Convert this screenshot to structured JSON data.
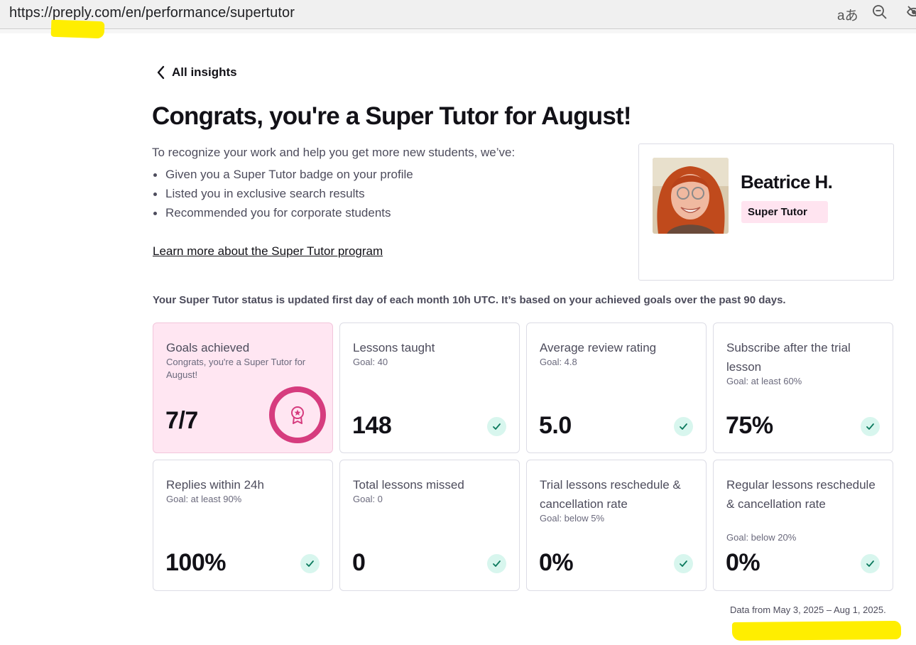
{
  "browser": {
    "url": "https://preply.com/en/performance/supertutor",
    "translate_icon": "aあ"
  },
  "header": {
    "back_label": "All insights",
    "title": "Congrats, you're a Super Tutor for August!"
  },
  "intro": {
    "lead": "To recognize your work and help you get more new students, we’ve:",
    "bullets": [
      "Given you a Super Tutor badge on your profile",
      "Listed you in exclusive search results",
      "Recommended you for corporate students"
    ],
    "learn_more": "Learn more about the Super Tutor program"
  },
  "profile": {
    "name": "Beatrice H.",
    "badge": "Super Tutor"
  },
  "status_note": "Your Super Tutor status is updated first day of each month 10h UTC. It’s based on your achieved goals over the past 90 days.",
  "metrics": [
    {
      "title": "Goals achieved",
      "subtitle": "Congrats, you're a Super Tutor for August!",
      "value": "7/7",
      "icon": "award-badge-icon"
    },
    {
      "title": "Lessons taught",
      "subtitle": "Goal: 40",
      "value": "148",
      "icon": "check-icon"
    },
    {
      "title": "Average review rating",
      "subtitle": "Goal: 4.8",
      "value": "5.0",
      "icon": "check-icon"
    },
    {
      "title": "Subscribe after the trial lesson",
      "subtitle": "Goal: at least 60%",
      "value": "75%",
      "icon": "check-icon"
    },
    {
      "title": "Replies within 24h",
      "subtitle": "Goal: at least 90%",
      "value": "100%",
      "icon": "check-icon"
    },
    {
      "title": "Total lessons missed",
      "subtitle": "Goal: 0",
      "value": "0",
      "icon": "check-icon"
    },
    {
      "title": "Trial lessons reschedule & cancellation rate",
      "subtitle": "Goal: below 5%",
      "value": "0%",
      "icon": "check-icon"
    },
    {
      "title": "Regular lessons reschedule & cancellation rate",
      "subtitle": "Goal: below 20%",
      "value": "0%",
      "icon": "check-icon"
    }
  ],
  "footer": {
    "data_range": "Data from May 3, 2025 – Aug 1, 2025."
  },
  "colors": {
    "accent_pink": "#d63c7e",
    "card_pink_bg": "#ffe6f2",
    "check_bg": "#d8f6ee",
    "check_fg": "#0c7a5e",
    "highlight": "#ffee00"
  }
}
